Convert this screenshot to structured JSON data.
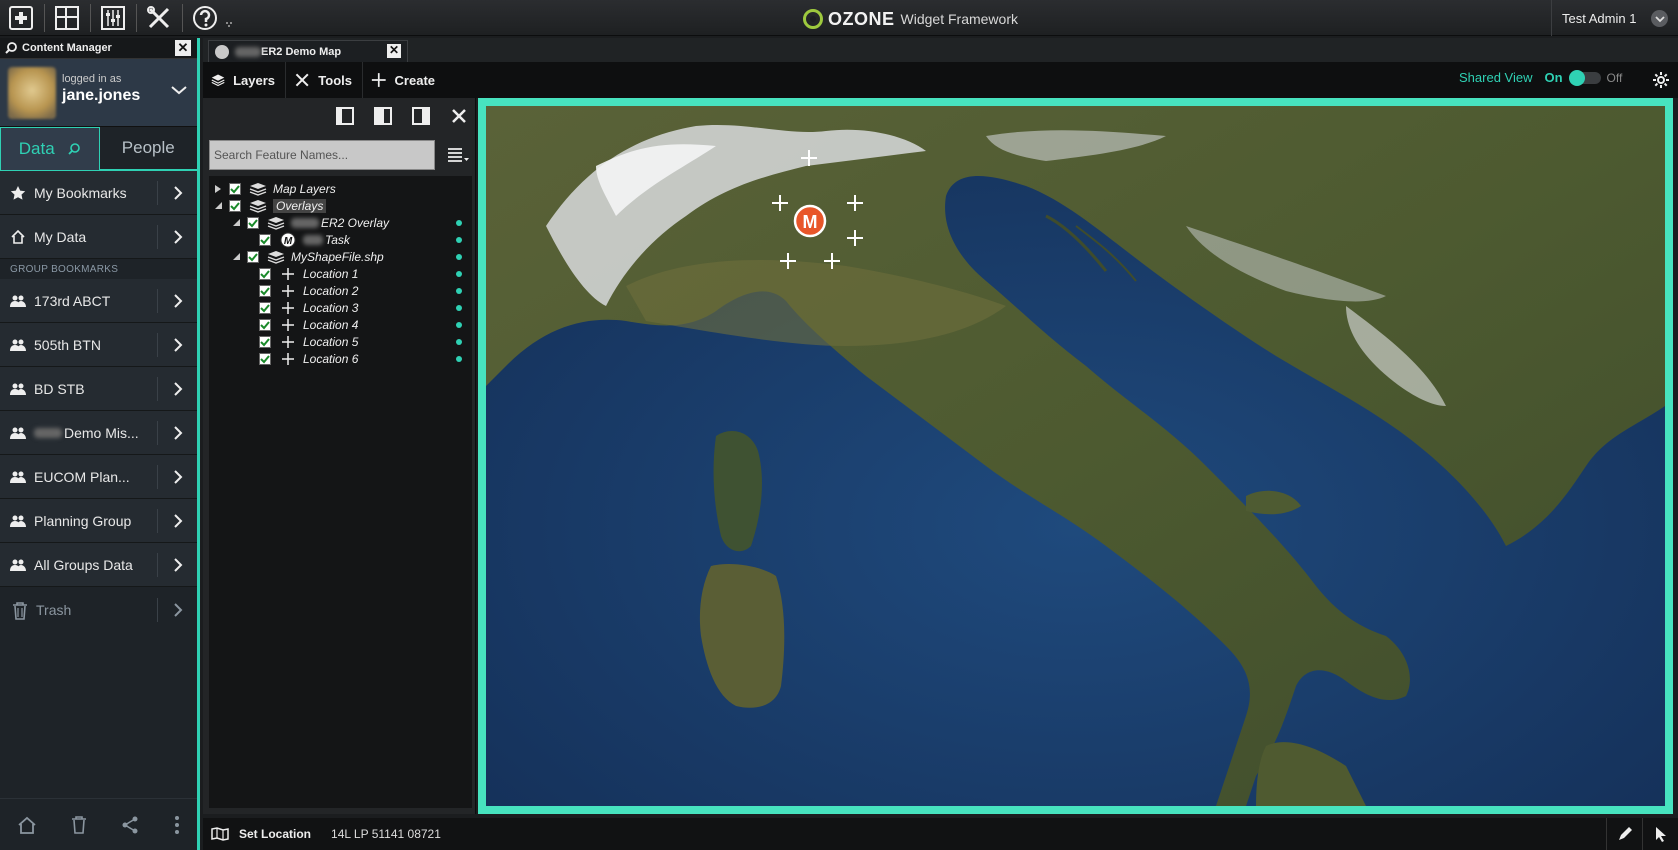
{
  "topbar": {
    "brand_word": "OZONE",
    "brand_sub": "Widget Framework",
    "user_name": "Test Admin 1"
  },
  "content_manager": {
    "title": "Content Manager",
    "logged_in_as": "logged in as",
    "username": "jane.jones",
    "tabs": {
      "data": "Data",
      "people": "People"
    },
    "items": [
      {
        "label": "My Bookmarks",
        "icon": "star-icon"
      },
      {
        "label": "My Data",
        "icon": "home-icon"
      }
    ],
    "group_section": "GROUP BOOKMARKS",
    "groups": [
      {
        "label": "173rd ABCT"
      },
      {
        "label": "505th BTN"
      },
      {
        "label": "BD STB"
      },
      {
        "label": "Demo Mis..."
      },
      {
        "label": "EUCOM Plan..."
      },
      {
        "label": "Planning Group"
      },
      {
        "label": "All Groups Data"
      }
    ],
    "trash": "Trash"
  },
  "map_widget": {
    "tab_title": "ER2 Demo Map",
    "toolbar": {
      "layers": "Layers",
      "tools": "Tools",
      "create": "Create"
    },
    "shared_view": {
      "label": "Shared View",
      "on": "On",
      "off": "Off"
    },
    "search_placeholder": "Search Feature Names...",
    "tree": {
      "map_layers": "Map Layers",
      "overlays": "Overlays",
      "er2_overlay": "ER2 Overlay",
      "task": "Task",
      "shapefile": "MyShapeFile.shp",
      "locations": [
        "Location 1",
        "Location 2",
        "Location 3",
        "Location 4",
        "Location 5",
        "Location 6"
      ]
    },
    "marker_label": "M",
    "status": {
      "set_location": "Set Location",
      "coordinate": "14L LP 51141 08721"
    }
  },
  "colors": {
    "accent": "#2fd1b4",
    "map_border": "#47e3bf",
    "marker": "#e8562a"
  }
}
